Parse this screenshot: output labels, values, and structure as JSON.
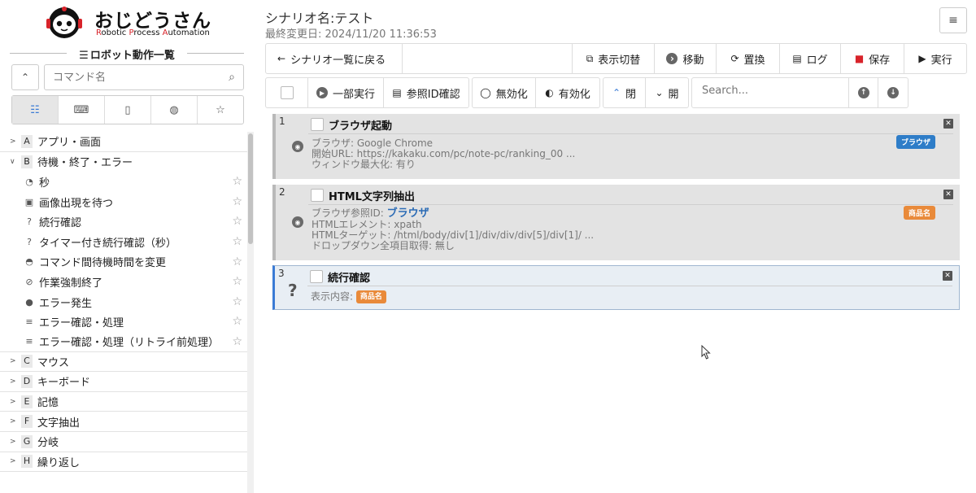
{
  "logo": {
    "title": "おじどうさん",
    "subtitle_r": "R",
    "subtitle_1": "obotic ",
    "subtitle_p": "P",
    "subtitle_2": "rocess ",
    "subtitle_a": "A",
    "subtitle_3": "utomation"
  },
  "sidebar": {
    "list_title": "ロボット動作一覧",
    "search_placeholder": "コマンド名",
    "categories": [
      {
        "letter": "A",
        "label": "アプリ・画面",
        "expanded": false
      },
      {
        "letter": "B",
        "label": "待機・終了・エラー",
        "expanded": true
      },
      {
        "letter": "C",
        "label": "マウス",
        "expanded": false
      },
      {
        "letter": "D",
        "label": "キーボード",
        "expanded": false
      },
      {
        "letter": "E",
        "label": "記憶",
        "expanded": false
      },
      {
        "letter": "F",
        "label": "文字抽出",
        "expanded": false
      },
      {
        "letter": "G",
        "label": "分岐",
        "expanded": false
      },
      {
        "letter": "H",
        "label": "繰り返し",
        "expanded": false
      }
    ],
    "items_b": [
      {
        "icon": "clock-icon",
        "label": "秒"
      },
      {
        "icon": "image-icon",
        "label": "画像出現を待つ"
      },
      {
        "icon": "question-icon",
        "label": "続行確認"
      },
      {
        "icon": "question-icon",
        "label": "タイマー付き続行確認（秒）"
      },
      {
        "icon": "speedometer-icon",
        "label": "コマンド間待機時間を変更"
      },
      {
        "icon": "ban-icon",
        "label": "作業強制終了"
      },
      {
        "icon": "bomb-icon",
        "label": "エラー発生"
      },
      {
        "icon": "database-icon",
        "label": "エラー確認・処理"
      },
      {
        "icon": "database-icon",
        "label": "エラー確認・処理（リトライ前処理）"
      }
    ]
  },
  "header": {
    "scenario_name": "シナリオ名:テスト",
    "last_modified": "最終変更日: 2024/11/20 11:36:53"
  },
  "toolbar1": {
    "back": "シナリオ一覧に戻る",
    "toggle_view": "表示切替",
    "move": "移動",
    "replace": "置換",
    "log": "ログ",
    "save": "保存",
    "run": "実行"
  },
  "toolbar2": {
    "partial_run": "一部実行",
    "ref_id_check": "参照ID確認",
    "disable": "無効化",
    "enable": "有効化",
    "close": "閉",
    "open": "開",
    "search_placeholder": "Search..."
  },
  "steps": [
    {
      "num": "1",
      "title": "ブラウザ起動",
      "lines": [
        "ブラウザ: Google Chrome",
        "開始URL: https://kakaku.com/pc/note-pc/ranking_00 ...",
        "ウィンドウ最大化: 有り"
      ],
      "tag": "ブラウザ"
    },
    {
      "num": "2",
      "title": "HTML文字列抽出",
      "ref_label": "ブラウザ参照ID: ",
      "ref_value": "ブラウザ",
      "lines": [
        "HTMLエレメント: xpath",
        "HTMLターゲット: /html/body/div[1]/div/div/div[5]/div[1]/ ...",
        "ドロップダウン全項目取得: 無し"
      ],
      "tag": "商品名"
    },
    {
      "num": "3",
      "title": "続行確認",
      "content_label": "表示内容: ",
      "content_tag": "商品名"
    }
  ]
}
